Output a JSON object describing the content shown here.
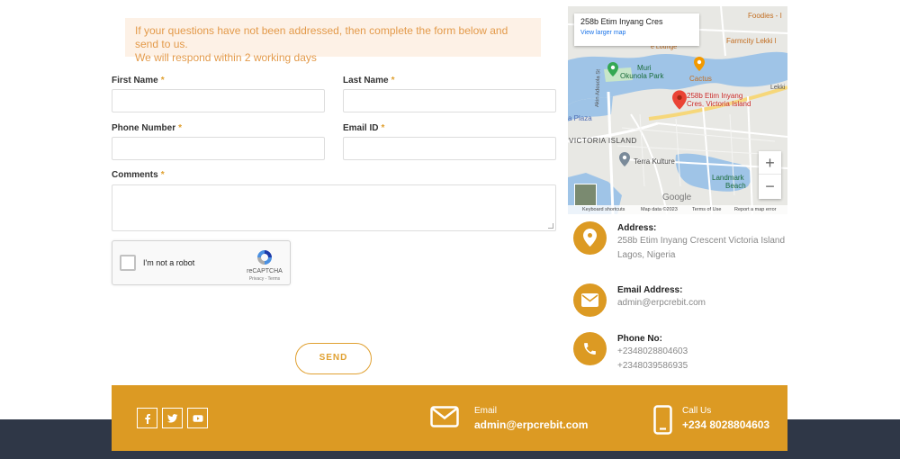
{
  "notice": {
    "line1": "If your questions have not been addressed, then complete the form below and send to us.",
    "line2": "We will respond within 2 working days"
  },
  "form": {
    "first_name_label": "First Name",
    "last_name_label": "Last Name",
    "phone_label": "Phone Number",
    "email_label": "Email ID",
    "comments_label": "Comments",
    "required_mark": "*",
    "recaptcha_label": "I'm not a robot",
    "recaptcha_brand": "reCAPTCHA",
    "recaptcha_links": "Privacy - Terms",
    "send_label": "SEND"
  },
  "map": {
    "place_title": "258b Etim Inyang Cres",
    "larger_map_link": "View larger map",
    "pin_label_1": "258b Etim Inyang",
    "pin_label_2": "Cres, Victoria Island",
    "labels": {
      "foodies": "Foodies - I",
      "farmcity": "Farmcity Lekki l",
      "cactus": "Cactus",
      "muri": "Muri",
      "okunola": "Okunola Park",
      "plaza": "a Plaza",
      "victoria": "VICTORIA ISLAND",
      "terra": "Terra Kulture",
      "landmark1": "Landmark",
      "landmark2": "Beach",
      "lekki": "Lekki",
      "adeola": "Akin Adesola St",
      "google": "Google",
      "ifeasure": "e Lounge"
    },
    "zoom_in": "+",
    "zoom_out": "−",
    "footer_shortcuts": "Keyboard shortcuts",
    "footer_data": "Map data ©2023",
    "footer_terms": "Terms of Use",
    "footer_report": "Report a map error"
  },
  "contact": {
    "address_title": "Address:",
    "address_line1": "258b Etim Inyang Crescent Victoria Island",
    "address_line2": "Lagos, Nigeria",
    "email_title": "Email Address:",
    "email_value": "admin@erpcrebit.com",
    "phone_title": "Phone No:",
    "phone_1": "+2348028804603",
    "phone_2": "+2348039586935"
  },
  "footer": {
    "email_label": "Email",
    "email_value": "admin@erpcrebit.com",
    "call_label": "Call Us",
    "call_value": "+234 8028804603"
  },
  "colors": {
    "accent": "#dc9a23",
    "notice_bg": "#fdf1e6",
    "navy": "#2f3747"
  }
}
